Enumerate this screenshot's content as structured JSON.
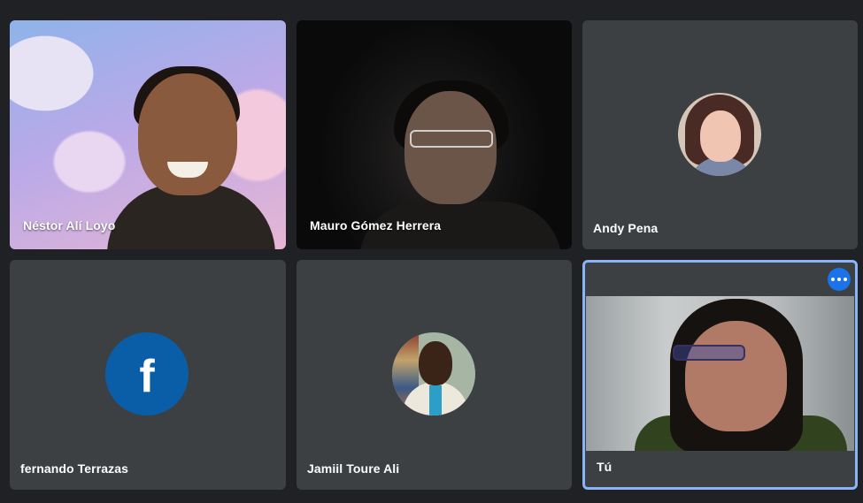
{
  "participants": [
    {
      "name": "Néstor Alí Loyo",
      "type": "video"
    },
    {
      "name": "Mauro Gómez Herrera",
      "type": "video"
    },
    {
      "name": "Andy Pena",
      "type": "avatar",
      "avatar": "profile-photo"
    },
    {
      "name": "fernando Terrazas",
      "type": "avatar",
      "avatar": "facebook-icon",
      "avatar_letter": "f",
      "avatar_color": "#0a5ea8"
    },
    {
      "name": "Jamiil Toure Ali",
      "type": "avatar",
      "avatar": "profile-photo"
    },
    {
      "name": "Tú",
      "type": "video",
      "is_self": true,
      "more_options_icon": "more-horiz-icon"
    }
  ],
  "colors": {
    "background": "#202124",
    "tile": "#3c4043",
    "self_border": "#8ab4f8",
    "more_button": "#1a73e8"
  }
}
